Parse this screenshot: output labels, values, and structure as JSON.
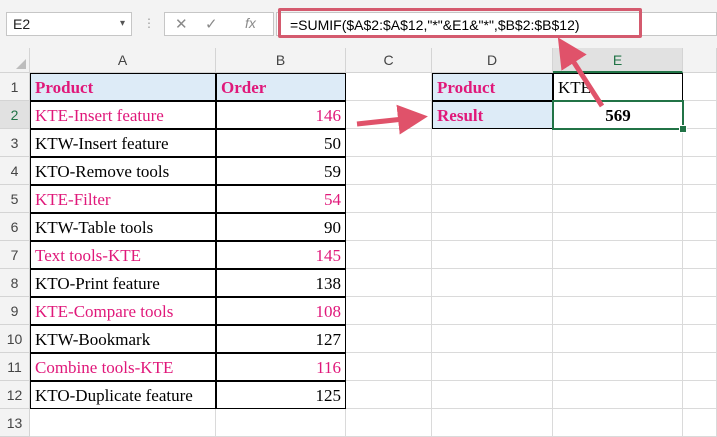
{
  "formula_bar": {
    "name_box": "E2",
    "name_box_chevron": "▾",
    "dots": "⋮",
    "cancel_icon": "✕",
    "enter_icon": "✓",
    "fx_label": "fx",
    "formula": "=SUMIF($A$2:$A$12,\"*\"&E1&\"*\",$B$2:$B$12)"
  },
  "columns": [
    "A",
    "B",
    "C",
    "D",
    "E"
  ],
  "rows": [
    "1",
    "2",
    "3",
    "4",
    "5",
    "6",
    "7",
    "8",
    "9",
    "10",
    "11",
    "12",
    "13"
  ],
  "headers": {
    "product": "Product",
    "order": "Order"
  },
  "table": [
    {
      "product": "KTE-Insert feature",
      "order": "146",
      "match": true
    },
    {
      "product": "KTW-Insert feature",
      "order": "50",
      "match": false
    },
    {
      "product": "KTO-Remove tools",
      "order": "59",
      "match": false
    },
    {
      "product": "KTE-Filter",
      "order": "54",
      "match": true
    },
    {
      "product": "KTW-Table tools",
      "order": "90",
      "match": false
    },
    {
      "product": "Text tools-KTE",
      "order": "145",
      "match": true
    },
    {
      "product": "KTO-Print feature",
      "order": "138",
      "match": false
    },
    {
      "product": "KTE-Compare tools",
      "order": "108",
      "match": true
    },
    {
      "product": "KTW-Bookmark",
      "order": "127",
      "match": false
    },
    {
      "product": "Combine tools-KTE",
      "order": "116",
      "match": true
    },
    {
      "product": "KTO-Duplicate feature",
      "order": "125",
      "match": false
    }
  ],
  "lookup": {
    "label_product": "Product",
    "value_product": "KTE",
    "label_result": "Result",
    "value_result": "569"
  },
  "colors": {
    "accent_pink": "#e0187a",
    "header_blue": "#ddebf7",
    "arrow": "#e0526a",
    "selection_green": "#217346"
  }
}
